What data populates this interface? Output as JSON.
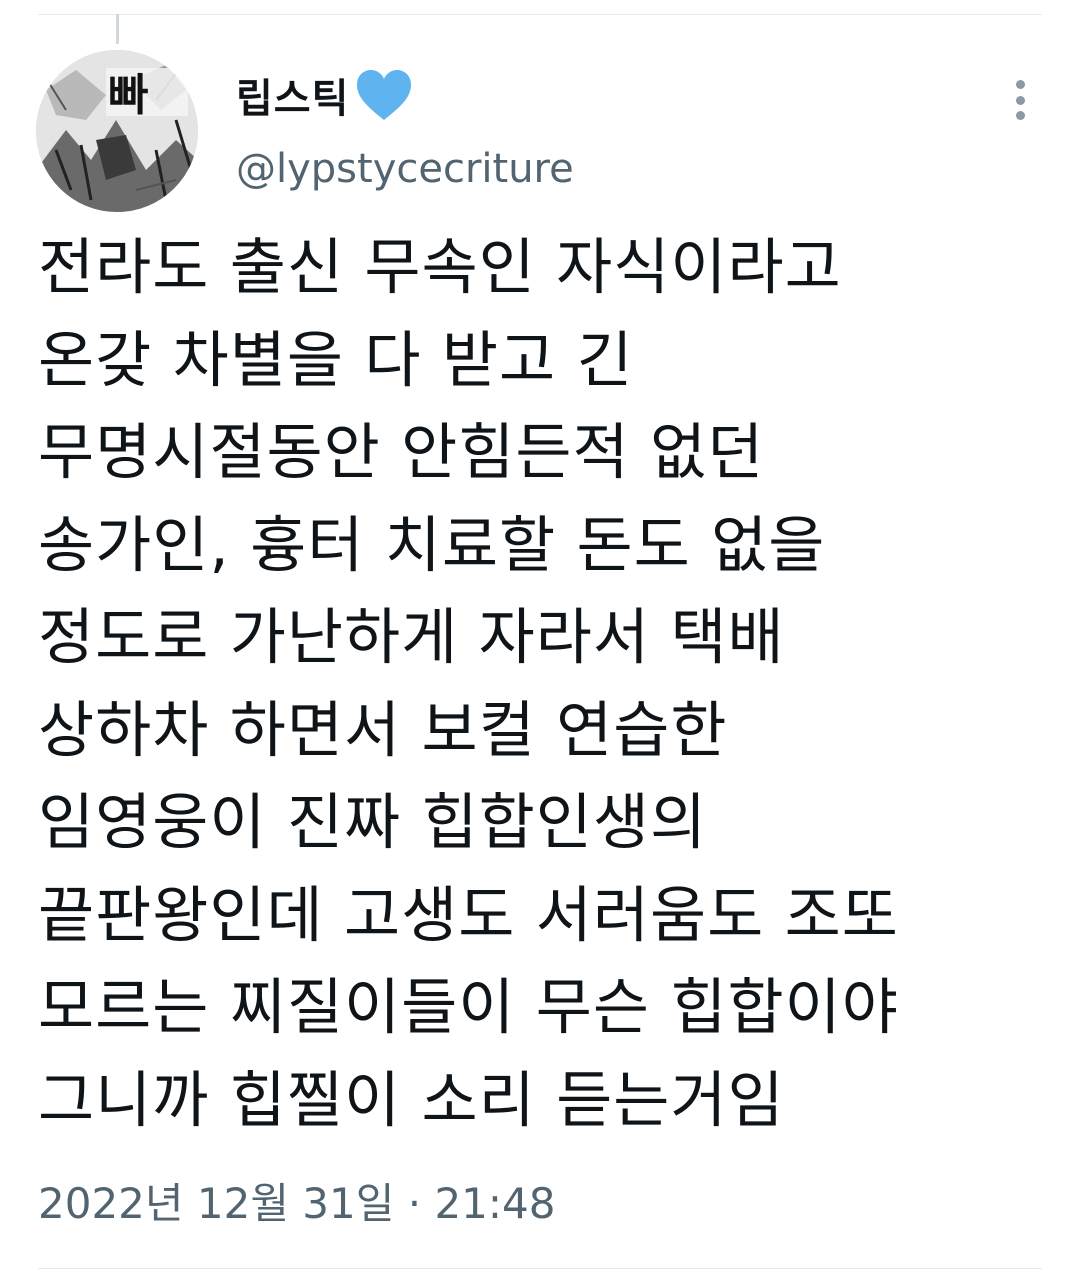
{
  "tweet": {
    "display_name": "립스틱",
    "handle": "@lypstycecriture",
    "avatar_text": "빠",
    "verified_heart_color": "#5fb3ee",
    "lines": [
      "전라도 출신 무속인 자식이라고",
      "온갖 차별을 다 받고 긴",
      "무명시절동안 안힘든적 없던",
      "송가인, 흉터 치료할 돈도 없을",
      "정도로 가난하게 자라서 택배",
      "상하차 하면서 보컬 연습한",
      "임영웅이 진짜 힙합인생의",
      "끝판왕인데 고생도 서러움도 조또",
      "모르는 찌질이들이 무슨 힙합이야",
      "그니까 힙찔이 소리 듣는거임"
    ],
    "timestamp": "2022년 12월 31일 · 21:48"
  },
  "icons": {
    "heart": "blue-heart-icon",
    "more": "more-options-icon"
  }
}
